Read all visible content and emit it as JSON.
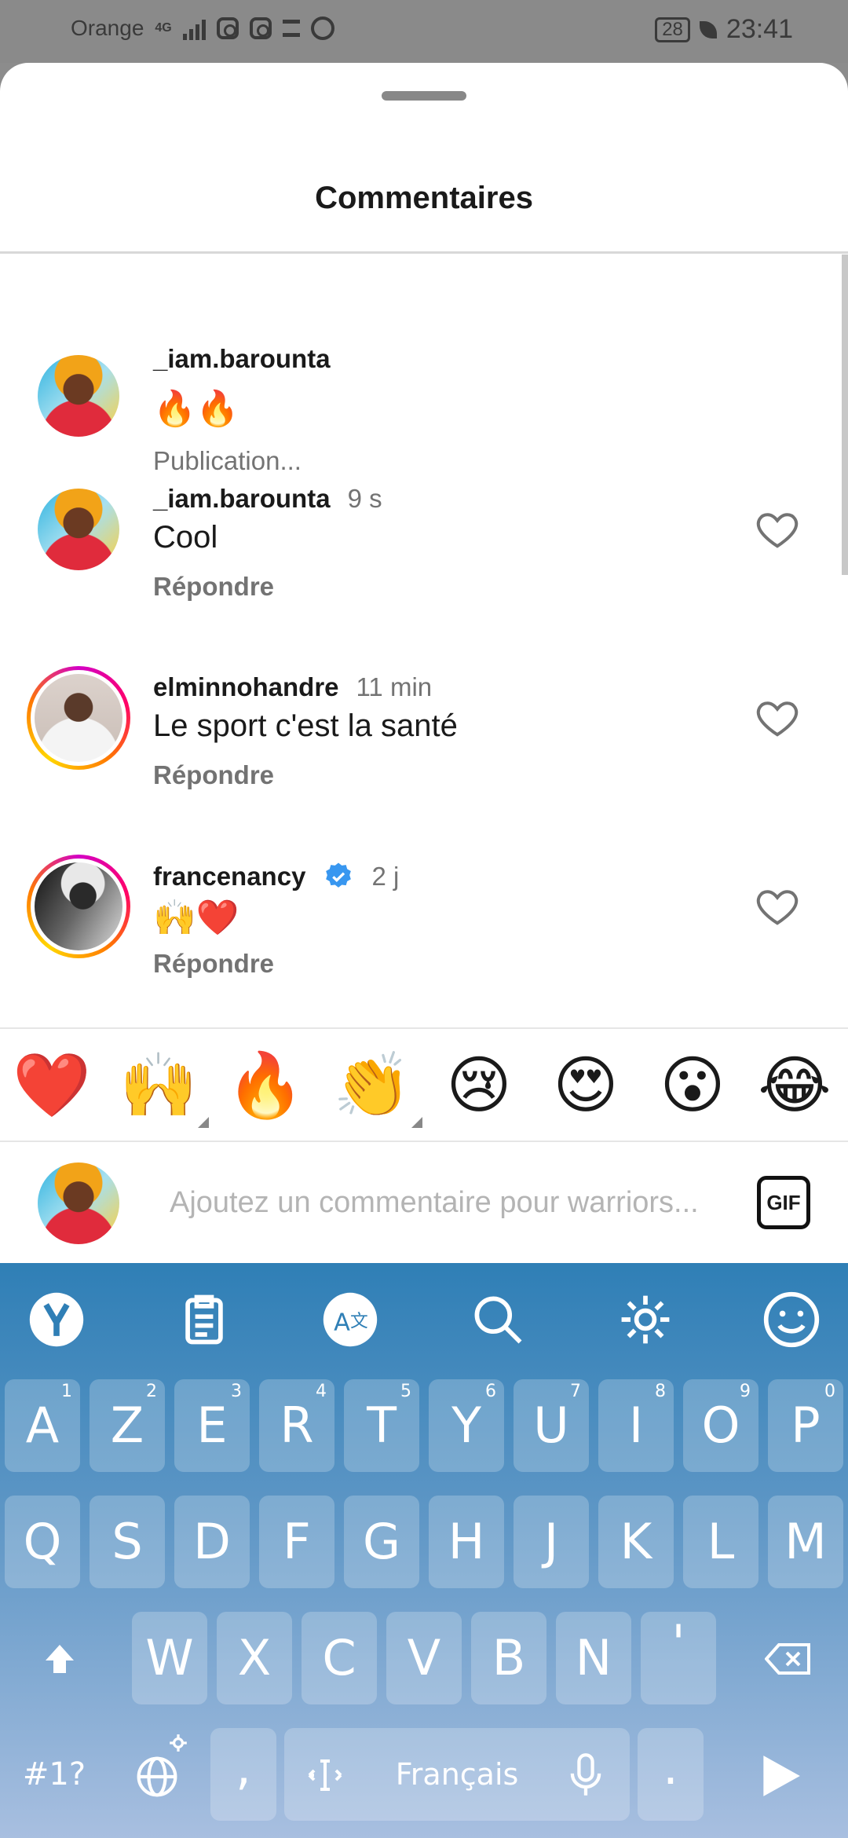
{
  "status_bar": {
    "carrier": "Orange",
    "network": "4G",
    "battery": "28",
    "time": "23:41"
  },
  "sheet": {
    "title": "Commentaires"
  },
  "caption": {
    "username": "_iam.barounta",
    "text": "🔥🔥",
    "sub": "Publication..."
  },
  "comments": [
    {
      "username": "_iam.barounta",
      "time": "9 s",
      "text": "Cool",
      "reply": "Répondre",
      "verified": false
    },
    {
      "username": "elminnohandre",
      "time": "11 min",
      "text": "Le sport c'est la santé",
      "reply": "Répondre",
      "verified": false
    },
    {
      "username": "francenancy",
      "time": "2 j",
      "text": "🙌❤️",
      "reply": "Répondre",
      "verified": true
    }
  ],
  "quick_reactions": [
    "❤️",
    "🙌",
    "🔥",
    "👏",
    "😢",
    "😍",
    "😮",
    "😂"
  ],
  "composer": {
    "placeholder": "Ajoutez un commentaire pour warriors...",
    "gif_label": "GIF"
  },
  "keyboard": {
    "row1": [
      {
        "key": "A",
        "hint": "1"
      },
      {
        "key": "Z",
        "hint": "2"
      },
      {
        "key": "E",
        "hint": "3"
      },
      {
        "key": "R",
        "hint": "4"
      },
      {
        "key": "T",
        "hint": "5"
      },
      {
        "key": "Y",
        "hint": "6"
      },
      {
        "key": "U",
        "hint": "7"
      },
      {
        "key": "I",
        "hint": "8"
      },
      {
        "key": "O",
        "hint": "9"
      },
      {
        "key": "P",
        "hint": "0"
      }
    ],
    "row2": [
      "Q",
      "S",
      "D",
      "F",
      "G",
      "H",
      "J",
      "K",
      "L",
      "M"
    ],
    "row3": [
      "W",
      "X",
      "C",
      "V",
      "B",
      "N",
      "'"
    ],
    "symbols_key": "#1?",
    "comma_key": ",",
    "space_label": "Français",
    "period_key": ".",
    "toolbar_icons": [
      "yandex-icon",
      "clipboard-icon",
      "translate-icon",
      "search-icon",
      "gear-icon",
      "smiley-icon"
    ]
  },
  "colors": {
    "accent_verified": "#3897f0",
    "keyboard_top": "#2f7fb6",
    "keyboard_bottom": "#a8bfe0"
  }
}
